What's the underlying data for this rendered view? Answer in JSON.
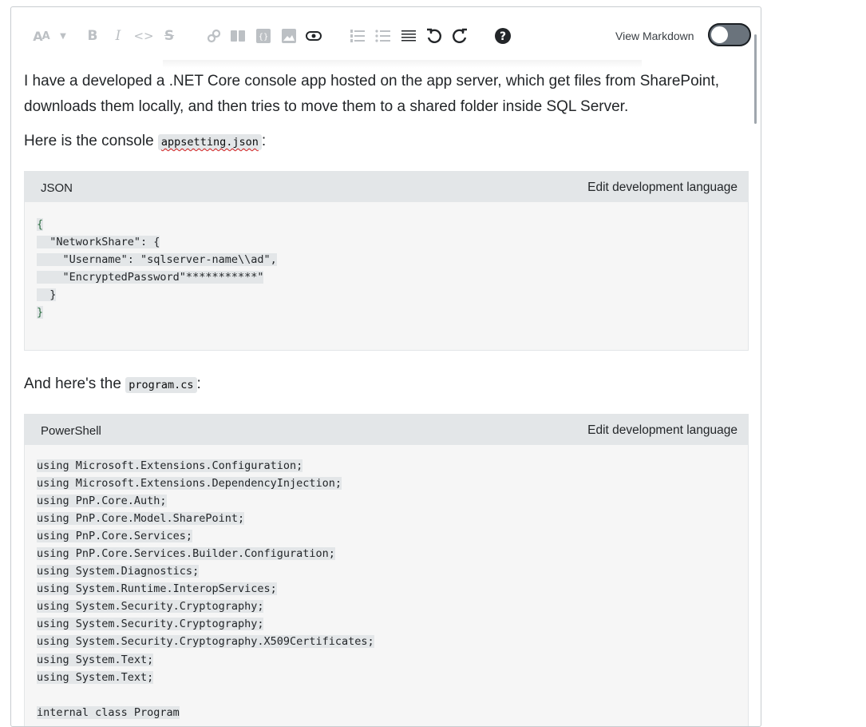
{
  "toolbar": {
    "view_markdown_label": "View Markdown",
    "icons": [
      "text-size-icon",
      "chevron-down-icon",
      "bold-icon",
      "italic-icon",
      "code-icon",
      "strikethrough-icon",
      "link-icon",
      "blockquote-icon",
      "code-block-icon",
      "image-icon",
      "snippet-icon",
      "ordered-list-icon",
      "unordered-list-icon",
      "horizontal-rule-icon",
      "undo-icon",
      "redo-icon",
      "help-icon"
    ]
  },
  "paragraphs": {
    "p1_line1": "I have a developed a .NET Core console app hosted on the app server, which get files from SharePoint,",
    "p1_line2": "downloads them locally, and then tries to move them to a shared folder inside SQL Server.",
    "p2_text": "Here is the console ",
    "p2_code": "appsetting.json",
    "p2_suffix": ":",
    "p3_text": "And here's the ",
    "p3_code": "program.cs",
    "p3_suffix": ":"
  },
  "code_blocks": [
    {
      "language": "JSON",
      "edit_label": "Edit development language",
      "lines": [
        "{",
        "  \"NetworkShare\": {",
        "    \"Username\": \"sqlserver-name\\\\ad\",",
        "    \"EncryptedPassword\"***********\"",
        "  }",
        "}"
      ]
    },
    {
      "language": "PowerShell",
      "edit_label": "Edit development language",
      "lines": [
        "using Microsoft.Extensions.Configuration;",
        "using Microsoft.Extensions.DependencyInjection;",
        "using PnP.Core.Auth;",
        "using PnP.Core.Model.SharePoint;",
        "using PnP.Core.Services;",
        "using PnP.Core.Services.Builder.Configuration;",
        "using System.Diagnostics;",
        "using System.Runtime.InteropServices;",
        "using System.Security.Cryptography;",
        "using System.Security.Cryptography;",
        "using System.Security.Cryptography.X509Certificates;",
        "using System.Text;",
        "using System.Text;",
        "",
        "internal class Program"
      ]
    }
  ]
}
